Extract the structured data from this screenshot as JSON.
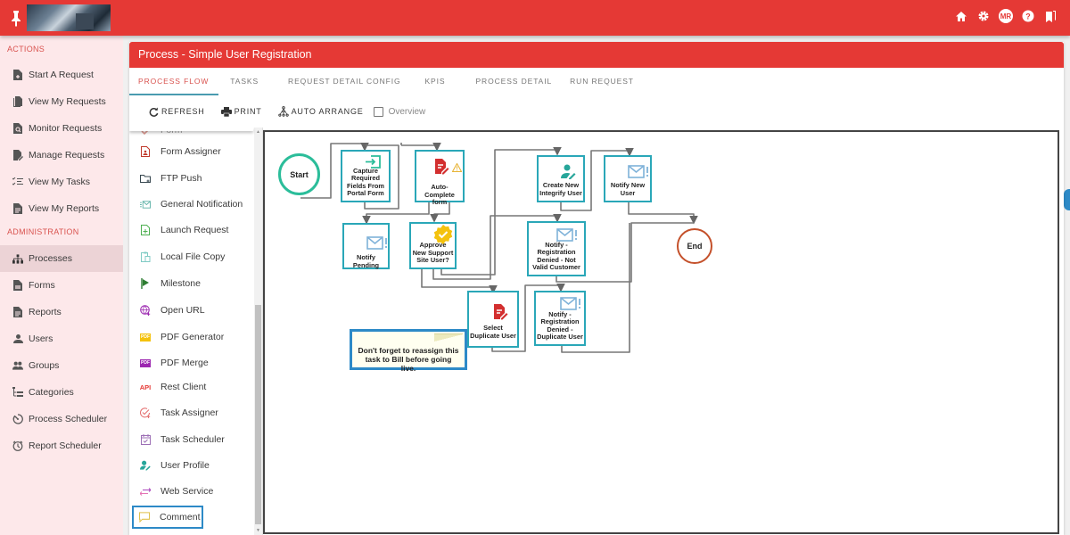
{
  "topbar": {
    "icons": [
      "pin-icon",
      "home-icon",
      "gear-icon",
      "avatar",
      "help-icon",
      "bookmarks-icon"
    ],
    "avatar_initials": "MR"
  },
  "sidebar": {
    "sections": [
      {
        "title": "ACTIONS",
        "items": [
          {
            "label": "Start A Request",
            "icon": "file-plus-icon"
          },
          {
            "label": "View My Requests",
            "icon": "files-icon"
          },
          {
            "label": "Monitor Requests",
            "icon": "file-search-icon"
          },
          {
            "label": "Manage Requests",
            "icon": "file-edit-icon"
          },
          {
            "label": "View My Tasks",
            "icon": "task-list-icon"
          },
          {
            "label": "View My Reports",
            "icon": "report-icon"
          }
        ]
      },
      {
        "title": "ADMINISTRATION",
        "items": [
          {
            "label": "Processes",
            "icon": "sitemap-icon",
            "active": true
          },
          {
            "label": "Forms",
            "icon": "form-icon"
          },
          {
            "label": "Reports",
            "icon": "report-icon"
          },
          {
            "label": "Users",
            "icon": "user-icon"
          },
          {
            "label": "Groups",
            "icon": "group-icon"
          },
          {
            "label": "Categories",
            "icon": "categories-icon"
          },
          {
            "label": "Process Scheduler",
            "icon": "timer-icon"
          },
          {
            "label": "Report Scheduler",
            "icon": "clock-icon"
          }
        ]
      }
    ]
  },
  "panel": {
    "title": "Process - Simple User Registration",
    "tabs": [
      {
        "label": "PROCESS FLOW",
        "active": true
      },
      {
        "label": "TASKS"
      },
      {
        "label": "REQUEST DETAIL CONFIG"
      },
      {
        "label": "KPIS"
      },
      {
        "label": "PROCESS DETAIL"
      },
      {
        "label": "RUN REQUEST"
      }
    ],
    "toolbar": {
      "refresh": "REFRESH",
      "print": "PRINT",
      "auto_arrange": "AUTO ARRANGE",
      "overview_label": "Overview",
      "overview_checked": false
    }
  },
  "palette": {
    "partial_item": "Form",
    "items": [
      {
        "label": "Form Assigner",
        "icon": "form-assigner-icon",
        "color": "#c0392b"
      },
      {
        "label": "FTP Push",
        "icon": "folder-upload-icon",
        "color": "#37474f"
      },
      {
        "label": "General Notification",
        "icon": "notification-icon",
        "color": "#5fb3a8"
      },
      {
        "label": "Launch Request",
        "icon": "launch-file-icon",
        "color": "#4caf50"
      },
      {
        "label": "Local File Copy",
        "icon": "file-copy-icon",
        "color": "#80cbc4"
      },
      {
        "label": "Milestone",
        "icon": "flag-icon",
        "color": "#2e7d32"
      },
      {
        "label": "Open URL",
        "icon": "globe-icon",
        "color": "#9c27b0"
      },
      {
        "label": "PDF Generator",
        "icon": "pdf-icon",
        "color": "#f4c20d",
        "glyph": "PDF"
      },
      {
        "label": "PDF Merge",
        "icon": "pdf-merge-icon",
        "color": "#9c27b0",
        "glyph": "PDF"
      },
      {
        "label": "Rest Client",
        "icon": "api-icon",
        "color": "#e53935",
        "glyph": "API"
      },
      {
        "label": "Task Assigner",
        "icon": "task-assigner-icon",
        "color": "#e57373"
      },
      {
        "label": "Task Scheduler",
        "icon": "calendar-icon",
        "color": "#9c6fb5"
      },
      {
        "label": "User Profile",
        "icon": "user-profile-icon",
        "color": "#26a69a"
      },
      {
        "label": "Web Service",
        "icon": "exchange-icon",
        "color": "#ab47bc"
      },
      {
        "label": "Comment",
        "icon": "comment-icon",
        "color": "#e0c14a",
        "selected": true
      }
    ]
  },
  "flow": {
    "start": "Start",
    "end": "End",
    "nodes": [
      {
        "id": "capture",
        "label": "Capture Required Fields From Portal Form",
        "icon": "form-input-icon"
      },
      {
        "id": "autocomplete",
        "label": "Auto-Complete form",
        "icon": "form-edit-icon",
        "warning": true
      },
      {
        "id": "notify_pending",
        "label": "Notify Pending",
        "icon": "mail-alert-icon"
      },
      {
        "id": "approve",
        "label": "Approve New Support Site User?",
        "icon": "approval-badge-icon"
      },
      {
        "id": "create_user",
        "label": "Create New Integrify User",
        "icon": "user-edit-icon"
      },
      {
        "id": "notify_new",
        "label": "Notify New User",
        "icon": "mail-alert-icon"
      },
      {
        "id": "notify_denied_invalid",
        "label": "Notify - Registration Denied - Not Valid Customer",
        "icon": "mail-alert-icon"
      },
      {
        "id": "select_duplicate",
        "label": "Select Duplicate User",
        "icon": "form-edit-icon"
      },
      {
        "id": "notify_denied_dup",
        "label": "Notify - Registration Denied - Duplicate User",
        "icon": "mail-alert-icon"
      }
    ],
    "comment": "Don't forget to reassign this task to Bill before going live."
  },
  "colors": {
    "brand_red": "#e53935",
    "node_border": "#2aa7b8",
    "start_border": "#2bbd9a",
    "end_border": "#c4502a",
    "selection_blue": "#2d8ac7"
  }
}
